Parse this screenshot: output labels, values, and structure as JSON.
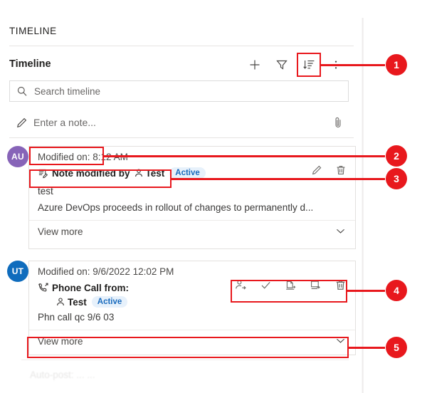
{
  "panel": {
    "section_title": "TIMELINE",
    "toolbar": {
      "label": "Timeline",
      "add_icon": "plus-icon",
      "filter_icon": "filter-icon",
      "sort_icon": "sort-icon",
      "more_icon": "more-vertical-icon"
    },
    "search": {
      "placeholder": "Search timeline",
      "value": "",
      "icon": "search-icon"
    },
    "note": {
      "placeholder": "Enter a note...",
      "value": "",
      "pencil_icon": "pencil-icon",
      "attach_icon": "paperclip-icon"
    }
  },
  "entries": [
    {
      "avatar_initials": "AU",
      "avatar_color": "#8764b8",
      "meta": "Modified on: 8:12 AM",
      "meta_label": "Modified on:",
      "meta_time": "8:12 AM",
      "type_icon": "note-icon",
      "title": "Note modified by",
      "person_icon": "person-icon",
      "person": "Test",
      "status": "Active",
      "body_line1": "test",
      "body_line2": "Azure DevOps proceeds in rollout of changes to permanently d...",
      "view_more": "View more",
      "chevron_icon": "chevron-down-icon",
      "actions": [
        {
          "name": "edit-icon"
        },
        {
          "name": "delete-icon"
        }
      ]
    },
    {
      "avatar_initials": "UT",
      "avatar_color": "#0f6cbd",
      "meta": "Modified on: 9/6/2022 12:02 PM",
      "meta_label": "Modified on:",
      "meta_time": "9/6/2022 12:02 PM",
      "type_icon": "phone-call-icon",
      "title": "Phone Call from:",
      "person_icon": "person-icon",
      "person": "Test",
      "status": "Active",
      "body_line1": "Phn call qc 9/6 03",
      "view_more": "View more",
      "chevron_icon": "chevron-down-icon",
      "actions": [
        {
          "name": "assign-icon"
        },
        {
          "name": "check-icon"
        },
        {
          "name": "add-to-queue-icon"
        },
        {
          "name": "convert-to-case-icon"
        },
        {
          "name": "delete-icon"
        }
      ]
    }
  ],
  "faded_row": {
    "text": "Auto-post: ... ..."
  },
  "annotations": {
    "accent_color": "#e8181d",
    "badges": [
      {
        "number": "1"
      },
      {
        "number": "2"
      },
      {
        "number": "3"
      },
      {
        "number": "4"
      },
      {
        "number": "5"
      }
    ]
  }
}
